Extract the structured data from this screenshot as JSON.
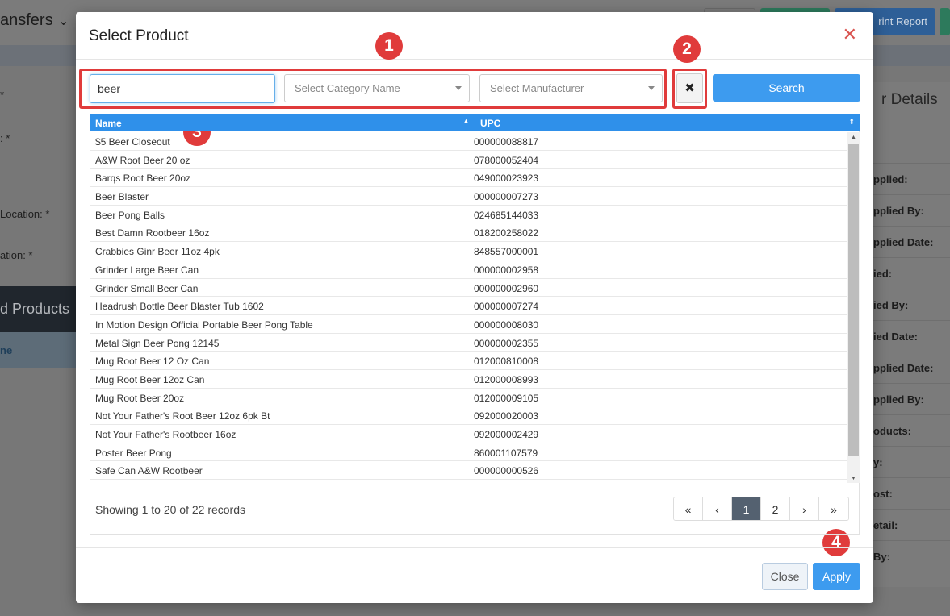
{
  "background": {
    "title": "ansfers",
    "buttons": [
      {
        "label": "",
        "color": "#7b7b7b"
      },
      {
        "label": "",
        "color": "#2d7a5c"
      },
      {
        "label": "rint Report",
        "color": "#2e5f97"
      },
      {
        "label": "",
        "color": "#2d7a5c"
      }
    ],
    "left_labels": [
      "*",
      ": *",
      "Location: *",
      "ation: *"
    ],
    "section_header": "d Products",
    "section_tab": "ne",
    "right_panel": {
      "header": "r Details",
      "items": [
        "pplied:",
        "pplied By:",
        "pplied Date:",
        "ied:",
        "ied By:",
        "ied Date:",
        "pplied Date:",
        "pplied By:",
        "oducts:",
        "y:",
        "ost:",
        "etail:",
        "By:"
      ]
    }
  },
  "modal": {
    "title": "Select Product",
    "close_icon": "close-icon",
    "search": {
      "value": "beer",
      "category_placeholder": "Select Category Name",
      "manufacturer_placeholder": "Select Manufacturer",
      "clear_icon": "✖",
      "search_label": "Search"
    },
    "table": {
      "columns": [
        "Name",
        "UPC"
      ],
      "rows": [
        {
          "name": "$5 Beer Closeout",
          "upc": "000000088817"
        },
        {
          "name": "A&W Root Beer 20 oz",
          "upc": "078000052404"
        },
        {
          "name": "Barqs Root Beer 20oz",
          "upc": "049000023923"
        },
        {
          "name": "Beer Blaster",
          "upc": "000000007273"
        },
        {
          "name": "Beer Pong Balls",
          "upc": "024685144033"
        },
        {
          "name": "Best Damn Rootbeer 16oz",
          "upc": "018200258022"
        },
        {
          "name": "Crabbies Ginr Beer 11oz 4pk",
          "upc": "848557000001"
        },
        {
          "name": "Grinder Large Beer Can",
          "upc": "000000002958"
        },
        {
          "name": "Grinder Small Beer Can",
          "upc": "000000002960"
        },
        {
          "name": "Headrush Bottle Beer Blaster Tub 1602",
          "upc": "000000007274"
        },
        {
          "name": "In Motion Design Official Portable Beer Pong Table",
          "upc": "000000008030"
        },
        {
          "name": "Metal Sign Beer Pong 12145",
          "upc": "000000002355"
        },
        {
          "name": "Mug Root Beer 12 Oz Can",
          "upc": "012000810008"
        },
        {
          "name": "Mug Root Beer 12oz Can",
          "upc": "012000008993"
        },
        {
          "name": "Mug Root Beer 20oz",
          "upc": "012000009105"
        },
        {
          "name": "Not Your Father's Root Beer 12oz 6pk Bt",
          "upc": "092000020003"
        },
        {
          "name": "Not Your Father's Rootbeer 16oz",
          "upc": "092000002429"
        },
        {
          "name": "Poster Beer Pong",
          "upc": "860001107579"
        },
        {
          "name": "Safe Can A&W Rootbeer",
          "upc": "000000000526"
        }
      ]
    },
    "records_text": "Showing 1 to 20 of 22 records",
    "pagination": {
      "first": "«",
      "prev": "‹",
      "pages": [
        "1",
        "2"
      ],
      "current": "1",
      "next": "›",
      "last": "»"
    },
    "footer": {
      "close_label": "Close",
      "apply_label": "Apply"
    },
    "callouts": [
      "1",
      "2",
      "3",
      "4"
    ],
    "accent_color": "#3d9bef",
    "callout_color": "#e03b3b"
  }
}
